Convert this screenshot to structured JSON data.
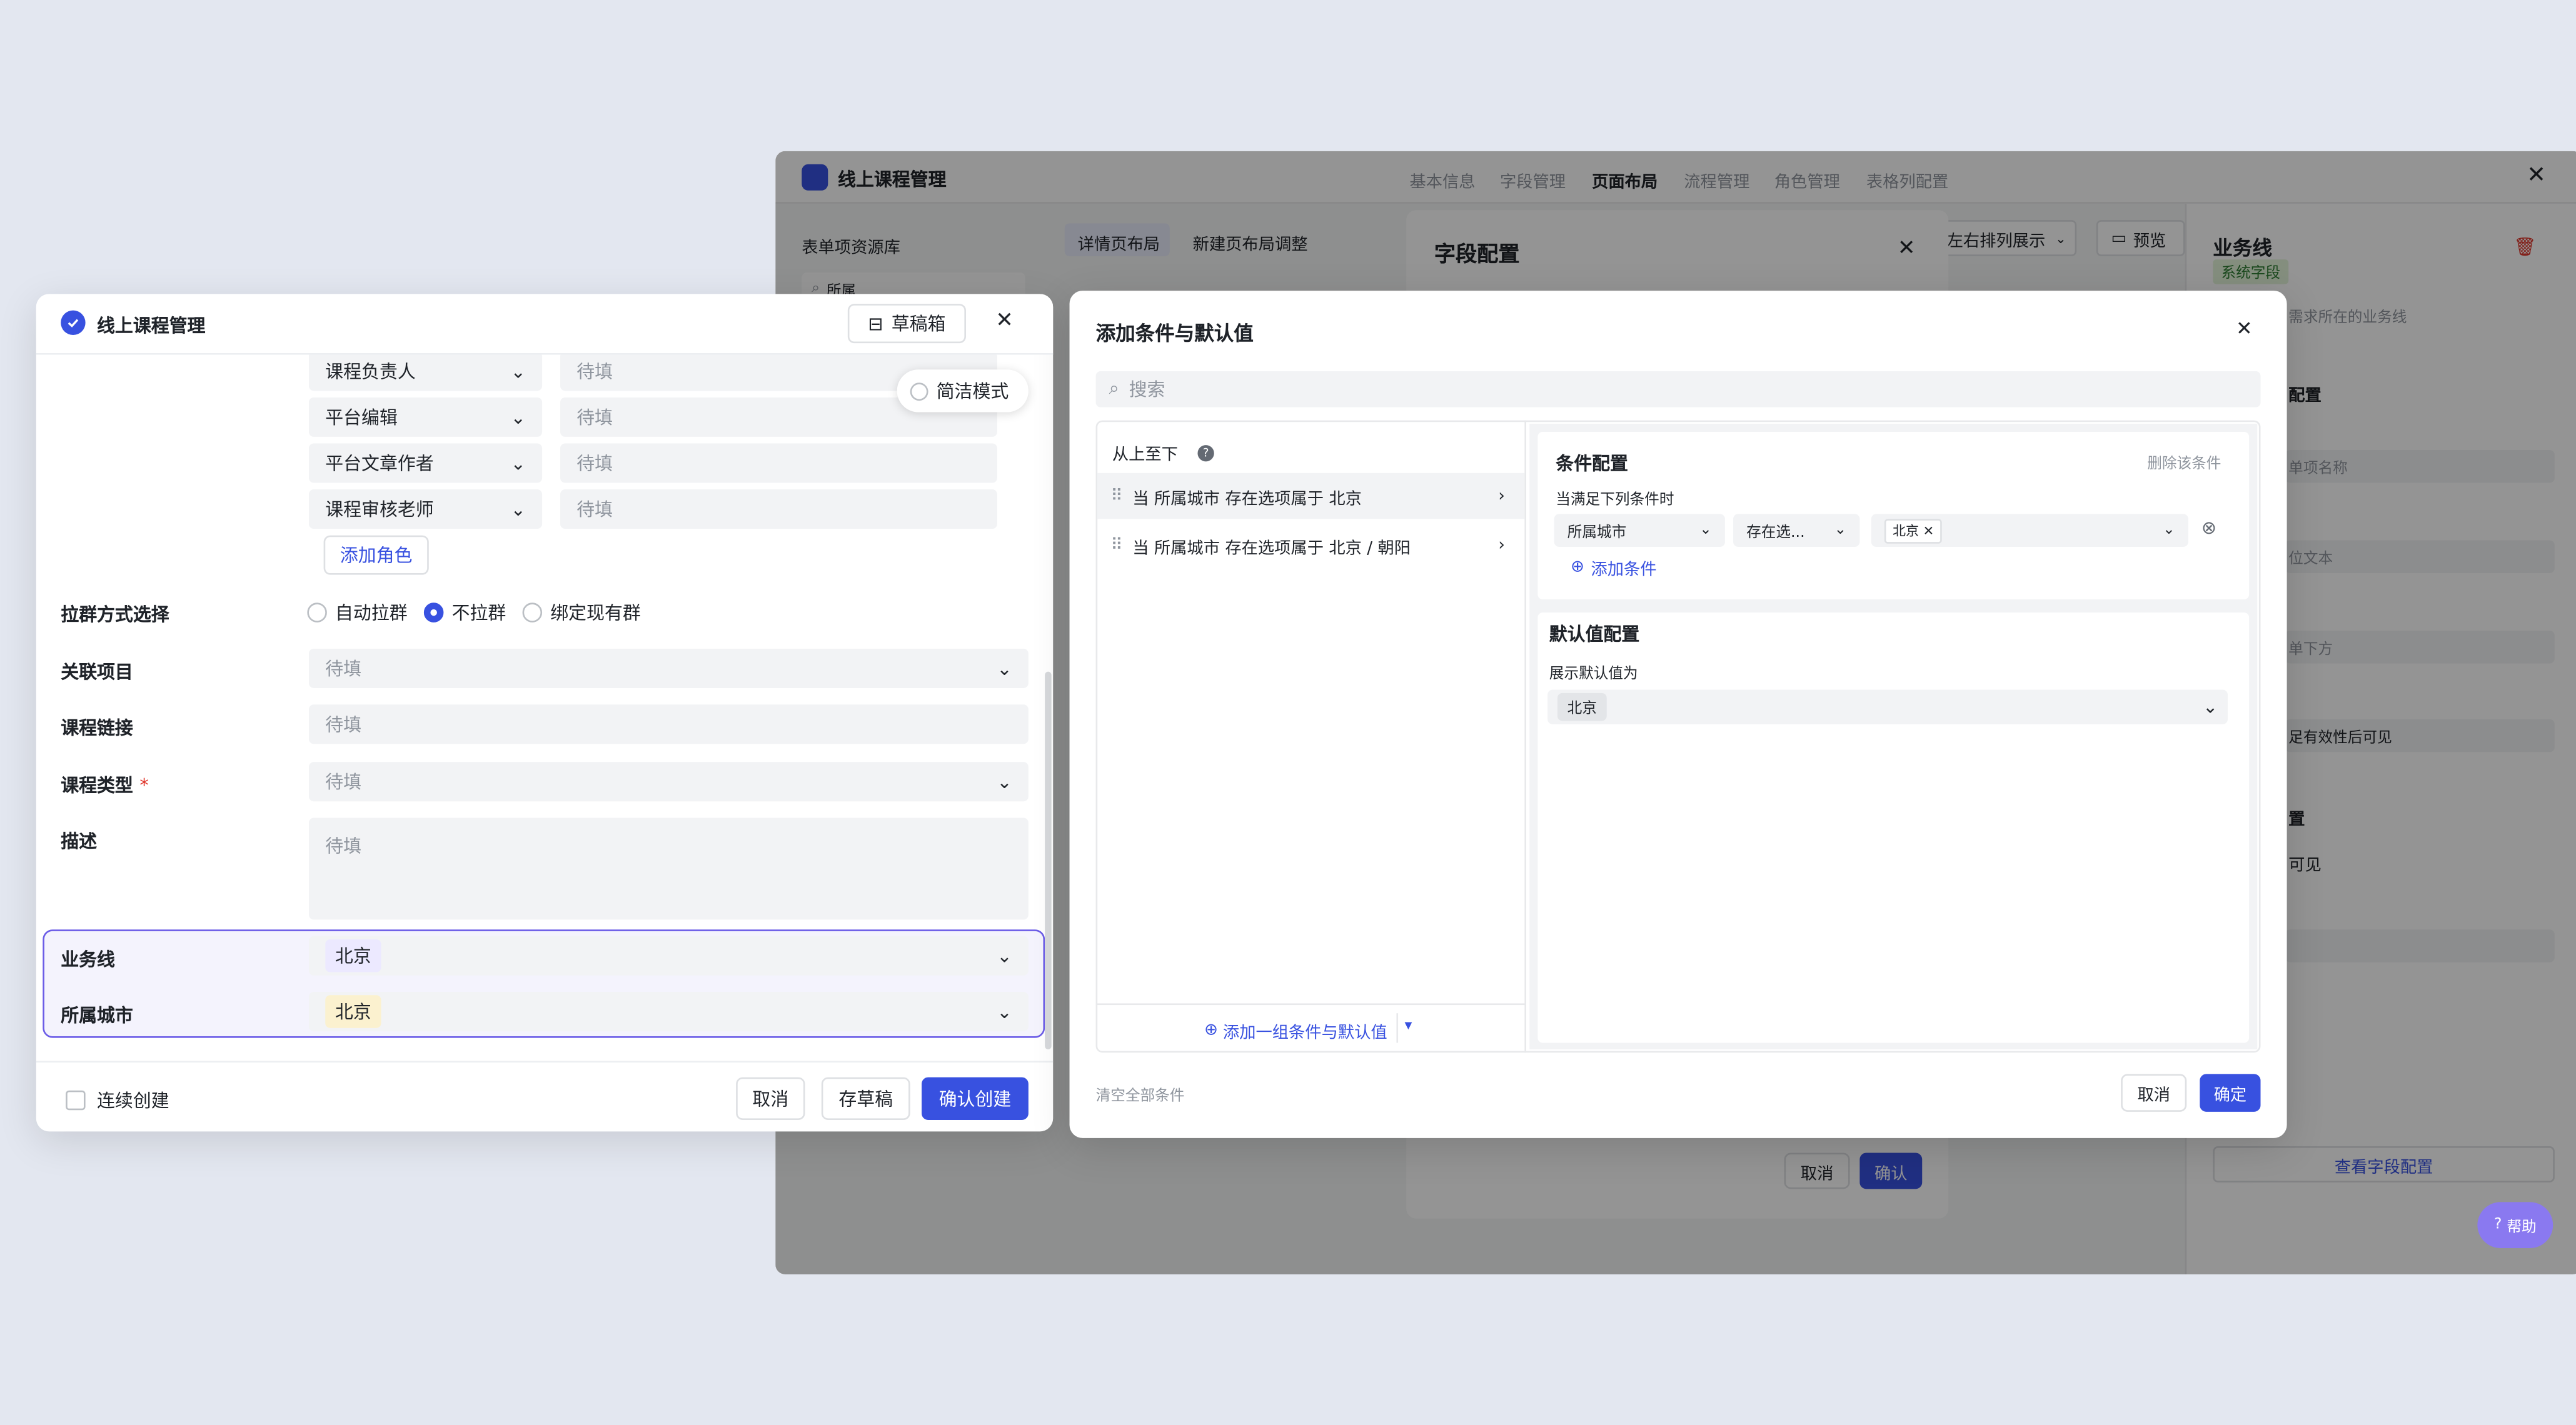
{
  "bg": {
    "app_title": "线上课程管理",
    "nav_tabs": [
      "基本信息",
      "字段管理",
      "页面布局",
      "流程管理",
      "角色管理",
      "表格列配置"
    ],
    "resource_lib": "表单项资源库",
    "search_value": "所属",
    "sub_tabs": [
      "详情页布局",
      "新建页布局调整"
    ],
    "layout_select": "左右排列展示",
    "preview": "预览",
    "field_config_title": "字段配置",
    "field_cancel": "取消",
    "field_confirm": "确认",
    "panel_title": "业务线",
    "system_field": "系统字段",
    "panel_desc": "需求所在的业务线",
    "panel_lines": [
      "配置",
      "单项名称",
      "位文本",
      "单下方",
      "足有效性后可见",
      "置",
      "可见"
    ],
    "view_config": "查看字段配置",
    "help": "帮助"
  },
  "left": {
    "title": "线上课程管理",
    "draft_box": "草稿箱",
    "roles": [
      {
        "role": "课程负责人",
        "placeholder": "待填"
      },
      {
        "role": "平台编辑",
        "placeholder": "待填"
      },
      {
        "role": "平台文章作者",
        "placeholder": "待填"
      },
      {
        "role": "课程审核老师",
        "placeholder": "待填"
      }
    ],
    "simple_mode": "简洁模式",
    "add_role": "添加角色",
    "group_method_label": "拉群方式选择",
    "group_options": [
      "自动拉群",
      "不拉群",
      "绑定现有群"
    ],
    "group_selected": "不拉群",
    "related_project_label": "关联项目",
    "course_link_label": "课程链接",
    "course_type_label": "课程类型",
    "required_mark": "*",
    "description_label": "描述",
    "placeholder": "待填",
    "business_line_label": "业务线",
    "business_line_value": "北京",
    "city_label": "所属城市",
    "city_value": "北京",
    "continuous_create": "连续创建",
    "cancel": "取消",
    "save_draft": "存草稿",
    "confirm_create": "确认创建"
  },
  "right": {
    "title": "添加条件与默认值",
    "search_placeholder": "搜索",
    "order_label": "从上至下",
    "conditions": [
      "当 所属城市 存在选项属于 北京",
      "当 所属城市 存在选项属于 北京 / 朝阳"
    ],
    "add_group": "添加一组条件与默认值",
    "cond_config_title": "条件配置",
    "delete_condition": "删除该条件",
    "when_label": "当满足下列条件时",
    "cond_field": "所属城市",
    "cond_operator": "存在选...",
    "cond_value_tag": "北京",
    "add_condition": "添加条件",
    "default_config_title": "默认值配置",
    "show_default_label": "展示默认值为",
    "default_value": "北京",
    "clear_all": "清空全部条件",
    "cancel": "取消",
    "confirm": "确定"
  },
  "colors": {
    "primary": "#3851e0",
    "highlight_border": "#6b5ce7",
    "tag_purple": "#ece9ff",
    "tag_yellow": "#fbf1cf"
  }
}
